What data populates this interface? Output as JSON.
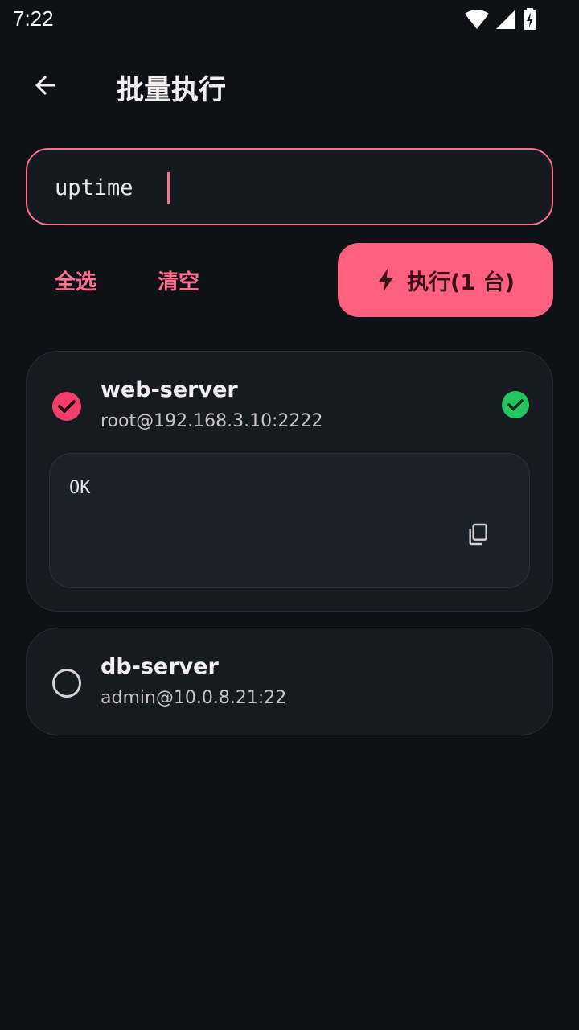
{
  "status_bar": {
    "time": "7:22",
    "icons": [
      "wifi-icon",
      "signal-icon",
      "battery-charging-icon"
    ]
  },
  "header": {
    "back_icon": "arrow-left-icon",
    "title": "批量执行"
  },
  "command": {
    "value": "uptime"
  },
  "actions": {
    "select_all": "全选",
    "clear": "清空",
    "run_label": "执行(1 台)",
    "run_icon": "bolt-icon"
  },
  "servers": [
    {
      "name": "web-server",
      "address": "root@192.168.3.10:2222",
      "selected": true,
      "status": "success",
      "output": "OK"
    },
    {
      "name": "db-server",
      "address": "admin@10.0.8.21:22",
      "selected": false
    }
  ],
  "colors": {
    "background": "#0e1116",
    "card": "#161b22",
    "accent": "#ff6080",
    "success": "#22c55e"
  }
}
